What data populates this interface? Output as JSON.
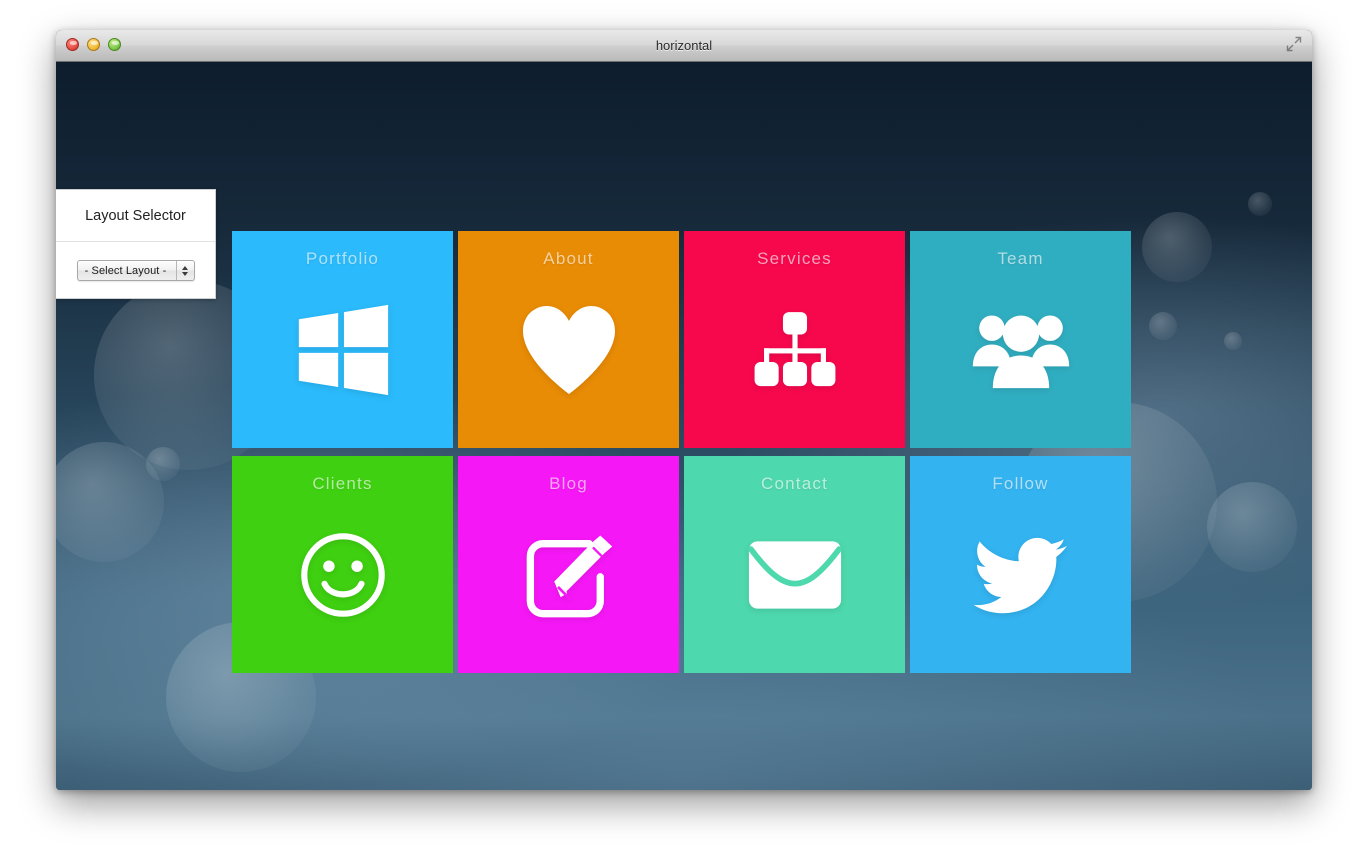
{
  "window": {
    "title": "horizontal",
    "controls": {
      "close_label": "close",
      "minimize_label": "minimize",
      "zoom_label": "zoom",
      "fullscreen_label": "fullscreen-toggle"
    }
  },
  "layout_panel": {
    "title": "Layout Selector",
    "select": {
      "value": "- Select Layout -",
      "placeholder": "- Select Layout -",
      "options": [
        "- Select Layout -"
      ]
    }
  },
  "tiles": [
    {
      "label": "Portfolio",
      "icon": "windows-icon",
      "color": "#2bbafb"
    },
    {
      "label": "About",
      "icon": "heart-icon",
      "color": "#e88b05"
    },
    {
      "label": "Services",
      "icon": "sitemap-icon",
      "color": "#f7084d"
    },
    {
      "label": "Team",
      "icon": "people-icon",
      "color": "#30aec1"
    },
    {
      "label": "Clients",
      "icon": "smiley-icon",
      "color": "#3fd011"
    },
    {
      "label": "Blog",
      "icon": "edit-icon",
      "color": "#f617f6"
    },
    {
      "label": "Contact",
      "icon": "envelope-icon",
      "color": "#4ed8ad"
    },
    {
      "label": "Follow",
      "icon": "twitter-icon",
      "color": "#33b3f0"
    }
  ],
  "colors": {
    "panel_background": "#ffffff",
    "titlebar_text": "#2b2b2b",
    "tile_label": "rgba(255,255,255,0.62)",
    "wallpaper_top": "#0d1d2d",
    "wallpaper_bottom": "#4a7189"
  }
}
